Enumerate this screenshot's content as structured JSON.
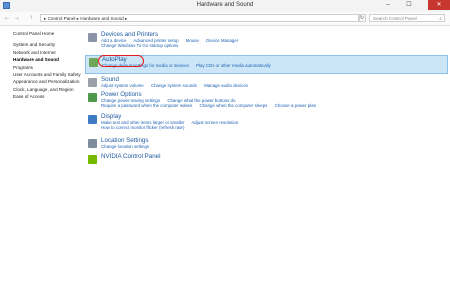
{
  "window": {
    "title": "Hardware and Sound",
    "min": "–",
    "max": "☐",
    "close": "✕"
  },
  "address": {
    "crumbs": "▸ Control Panel  ▸  Hardware and Sound  ▸",
    "search_placeholder": "Search Control Panel"
  },
  "nav": {
    "back": "←",
    "forward": "→",
    "up": "↑",
    "refresh": "↻"
  },
  "sidebar": {
    "items": [
      "Control Panel Home",
      "System and Security",
      "Network and Internet",
      "Hardware and Sound",
      "Programs",
      "User Accounts and Family Safety",
      "Appearance and Personalization",
      "Clock, Language, and Region",
      "Ease of Access"
    ]
  },
  "categories": [
    {
      "title": "Devices and Printers",
      "links": [
        "Add a device",
        "Advanced printer setup",
        "Mouse",
        "Device Manager"
      ],
      "links2": [
        "Change Windows To Go startup options"
      ]
    },
    {
      "title": "AutoPlay",
      "links": [
        "Change default settings for media or devices",
        "Play CDs or other media automatically"
      ]
    },
    {
      "title": "Sound",
      "links": [
        "Adjust system volume",
        "Change system sounds",
        "Manage audio devices"
      ]
    },
    {
      "title": "Power Options",
      "links": [
        "Change power-saving settings",
        "Change what the power buttons do"
      ],
      "links2": [
        "Require a password when the computer wakes",
        "Change when the computer sleeps",
        "Choose a power plan"
      ]
    },
    {
      "title": "Display",
      "links": [
        "Make text and other items larger or smaller",
        "Adjust screen resolution"
      ],
      "links2": [
        "How to correct monitor flicker (refresh rate)"
      ]
    },
    {
      "title": "Location Settings",
      "links": [
        "Change location settings"
      ]
    },
    {
      "title": "NVIDIA Control Panel",
      "links": []
    }
  ]
}
